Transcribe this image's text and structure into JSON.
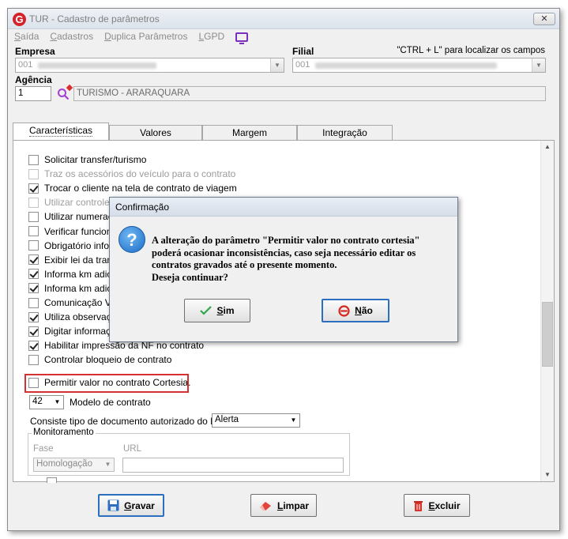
{
  "window": {
    "title": "TUR - Cadastro de parâmetros",
    "logo_letter": "G",
    "close_label": "✕"
  },
  "menu": {
    "items": [
      "Saída",
      "Cadastros",
      "Duplica Parâmetros",
      "LGPD"
    ]
  },
  "empresa": {
    "label": "Empresa",
    "value": "001"
  },
  "filial": {
    "label": "Filial",
    "value": "001",
    "hint": "\"CTRL + L\" para localizar os campos"
  },
  "agencia": {
    "label": "Agência",
    "code": "1",
    "name": "TURISMO - ARARAQUARA"
  },
  "tabs": [
    {
      "label": "Características",
      "active": true
    },
    {
      "label": "Valores",
      "active": false
    },
    {
      "label": "Margem",
      "active": false
    },
    {
      "label": "Integração",
      "active": false
    }
  ],
  "checkboxes": [
    {
      "label": "Solicitar transfer/turismo",
      "checked": false,
      "enabled": true
    },
    {
      "label": "Traz os acessórios do veículo para o contrato",
      "checked": false,
      "enabled": false
    },
    {
      "label": "Trocar o cliente na tela de contrato de viagem",
      "checked": true,
      "enabled": true
    },
    {
      "label": "Utilizar controle de formulários do retaguarda",
      "checked": false,
      "enabled": false
    },
    {
      "label": "Utilizar numeração",
      "checked": false,
      "enabled": true
    },
    {
      "label": "Verificar funcionári",
      "checked": false,
      "enabled": true
    },
    {
      "label": "Obrigatório informa",
      "checked": false,
      "enabled": true
    },
    {
      "label": "Exibir lei da transpo",
      "checked": true,
      "enabled": true
    },
    {
      "label": "Informa km adicion",
      "checked": true,
      "enabled": true
    },
    {
      "label": "Informa km adicion",
      "checked": true,
      "enabled": true
    },
    {
      "label": "Comunicação Velte",
      "checked": false,
      "enabled": true
    },
    {
      "label": "Utiliza observação",
      "checked": true,
      "enabled": true
    },
    {
      "label": "Digitar informações",
      "checked": true,
      "enabled": true
    },
    {
      "label": "Habilitar impressão da NF no contrato",
      "checked": true,
      "enabled": true
    },
    {
      "label": "Controlar bloqueio de contrato",
      "checked": false,
      "enabled": true
    },
    {
      "label": "Permitir valor no contrato Cortesia.",
      "checked": false,
      "enabled": true
    }
  ],
  "modelo": {
    "value": "42",
    "label": "Modelo de contrato"
  },
  "consiste": {
    "label": "Consiste tipo de documento autorizado do DVS",
    "value": "Alerta"
  },
  "monitoramento": {
    "title": "Monitoramento",
    "fase_label": "Fase",
    "fase_value": "Homologação",
    "url_label": "URL",
    "url_value": ""
  },
  "buttons": {
    "gravar": "Gravar",
    "limpar": "Limpar",
    "excluir": "Excluir"
  },
  "dialog": {
    "title": "Confirmação",
    "icon": "?",
    "message_lines": [
      "A alteração do parâmetro \"Permitir valor no contrato cortesia\"",
      "poderá ocasionar inconsistências, caso seja necessário editar os",
      "contratos gravados até o presente momento.",
      "Deseja continuar?"
    ],
    "yes_label": "Sim",
    "no_label": "Não"
  },
  "colors": {
    "accent": "#2c6fbf",
    "highlight": "#d73030",
    "logo": "#d2232a",
    "lgpd": "#7b2fbe"
  }
}
